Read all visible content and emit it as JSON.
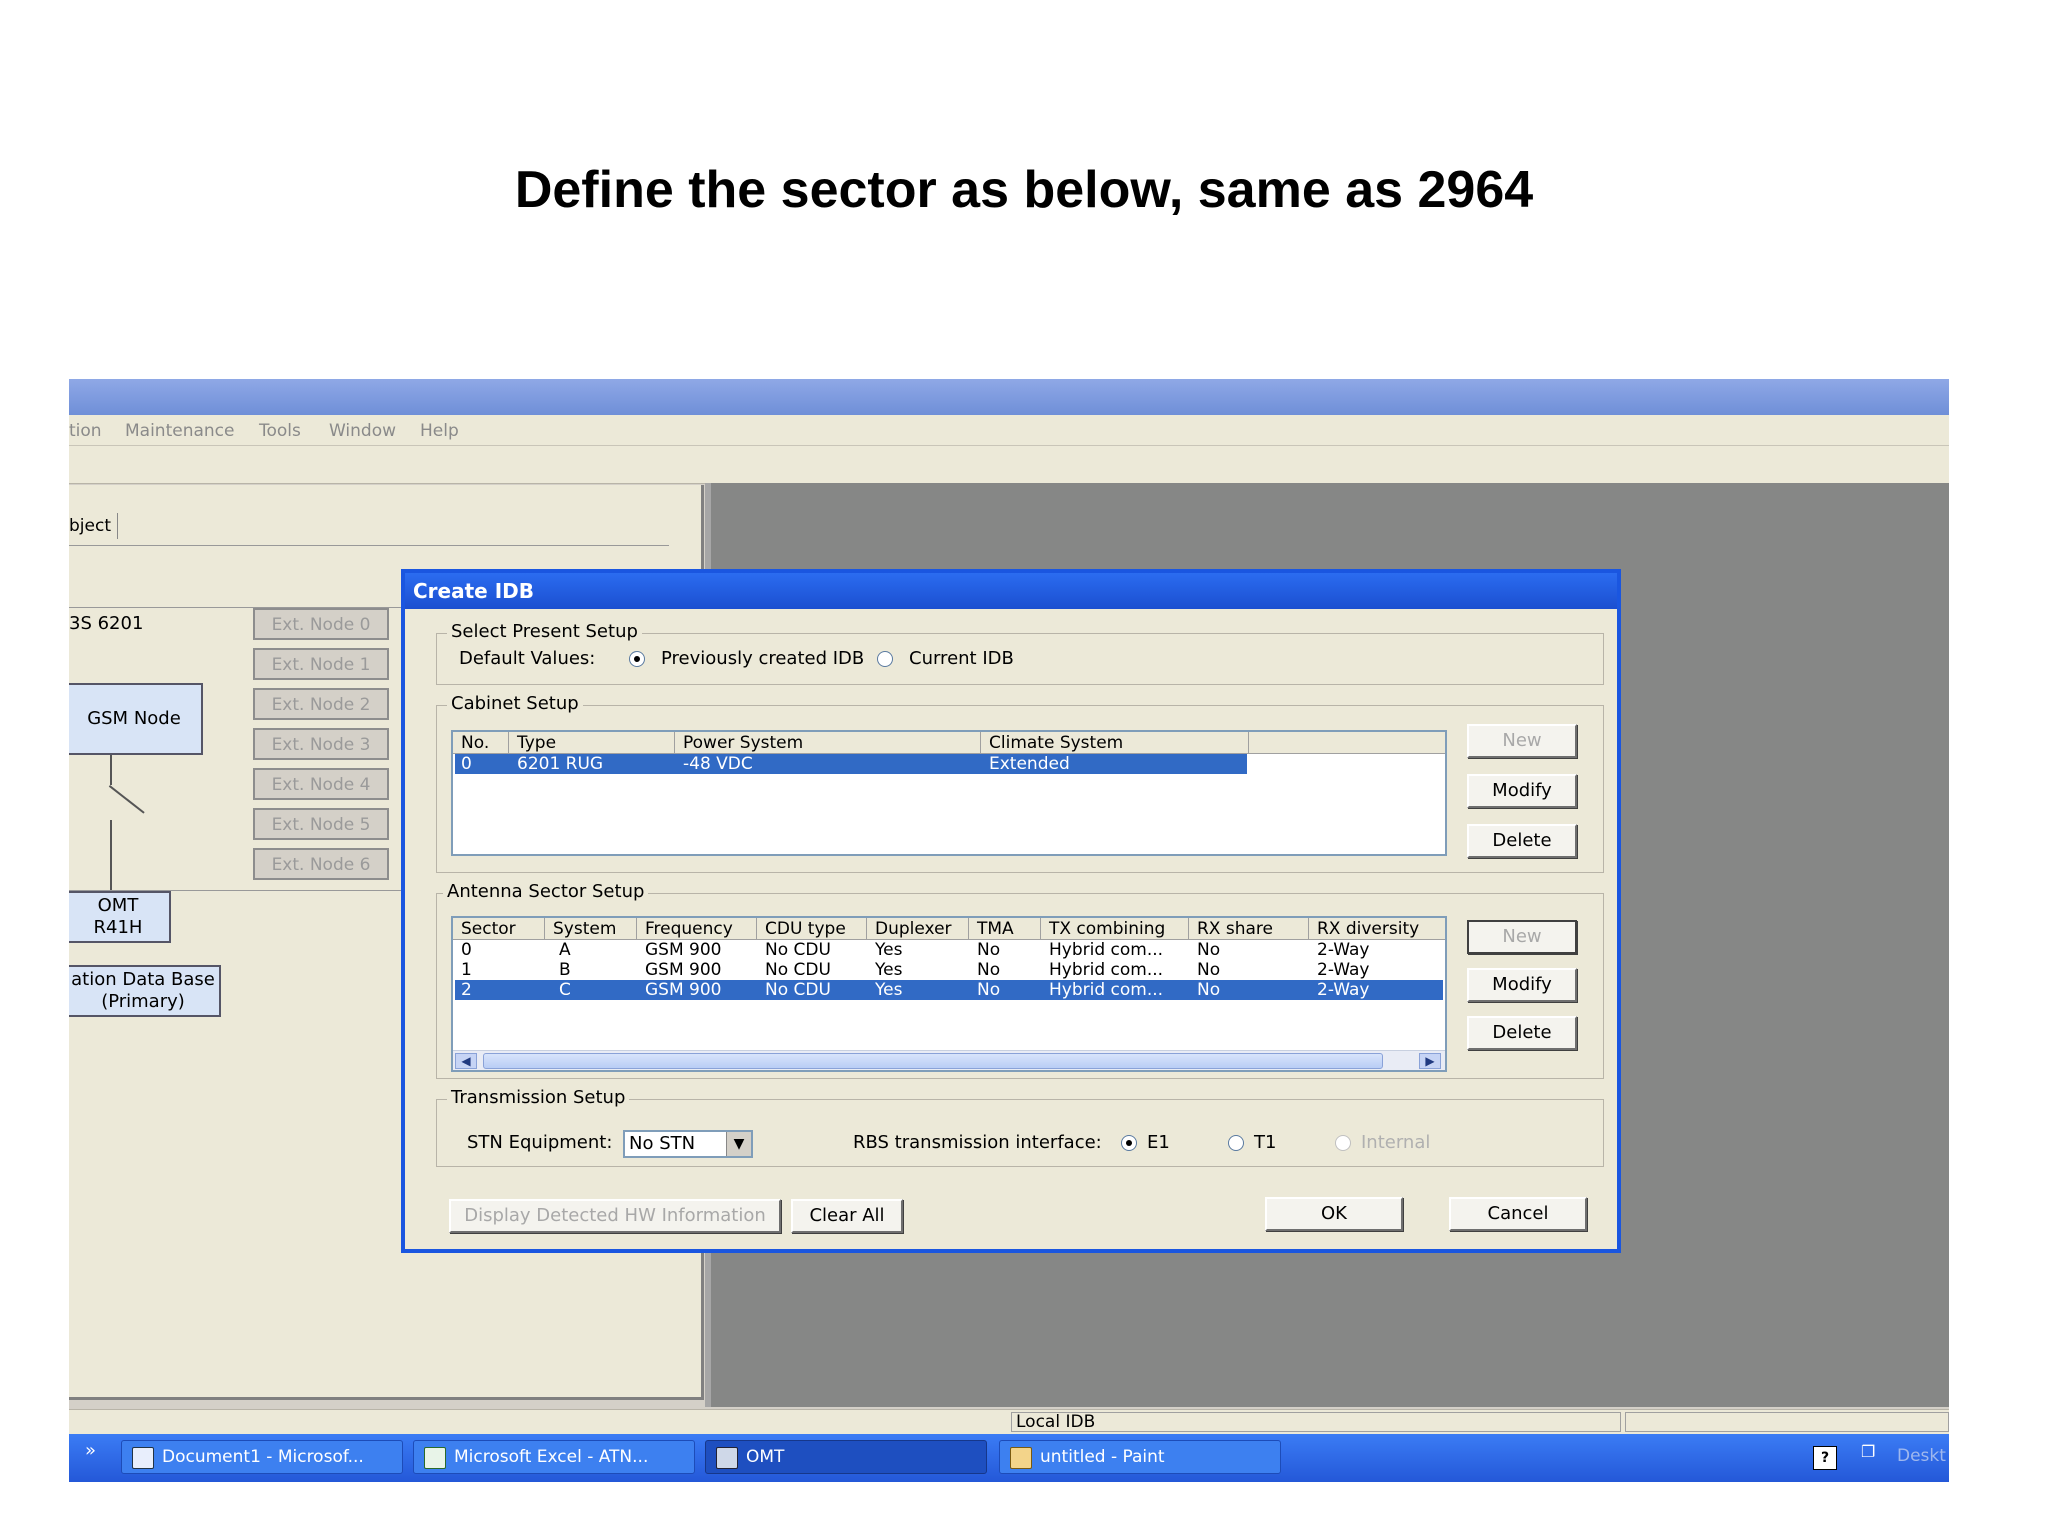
{
  "slide": {
    "title": "Define the sector as below, same as 2964"
  },
  "menu": [
    "tion",
    "Maintenance",
    "Tools",
    "Window",
    "Help"
  ],
  "left_panel": {
    "tab": "bject",
    "rbs_label": "3S 6201",
    "ext_nodes": [
      "Ext. Node 0",
      "Ext. Node 1",
      "Ext. Node 2",
      "Ext. Node 3",
      "Ext. Node 4",
      "Ext. Node 5",
      "Ext. Node 6"
    ],
    "gsm_node": "GSM Node",
    "omt_line1": "OMT",
    "omt_line2": "R41H",
    "db_line1": "ation Data Base",
    "db_line2": "(Primary)"
  },
  "dialog": {
    "title": "Create IDB",
    "select_setup": {
      "label": "Select Present Setup",
      "default_values": "Default Values:",
      "opt_previous": "Previously created IDB",
      "opt_current": "Current IDB",
      "selected": "Previously created IDB"
    },
    "cabinet": {
      "label": "Cabinet Setup",
      "columns": [
        "No.",
        "Type",
        "Power System",
        "Climate System"
      ],
      "rows": [
        [
          "0",
          "6201 RUG",
          "-48 VDC",
          "Extended"
        ]
      ],
      "buttons": {
        "new": "New",
        "modify": "Modify",
        "delete": "Delete"
      }
    },
    "antenna": {
      "label": "Antenna Sector Setup",
      "columns": [
        "Sector",
        "System",
        "Frequency",
        "CDU type",
        "Duplexer",
        "TMA",
        "TX combining",
        "RX share",
        "RX diversity"
      ],
      "rows": [
        [
          "0",
          "A",
          "GSM 900",
          "No CDU",
          "Yes",
          "No",
          "Hybrid com...",
          "No",
          "2-Way"
        ],
        [
          "1",
          "B",
          "GSM 900",
          "No CDU",
          "Yes",
          "No",
          "Hybrid com...",
          "No",
          "2-Way"
        ],
        [
          "2",
          "C",
          "GSM 900",
          "No CDU",
          "Yes",
          "No",
          "Hybrid com...",
          "No",
          "2-Way"
        ]
      ],
      "selected_row": 2,
      "buttons": {
        "new": "New",
        "modify": "Modify",
        "delete": "Delete"
      }
    },
    "transmission": {
      "label": "Transmission Setup",
      "stn_label": "STN Equipment:",
      "stn_value": "No STN",
      "rbs_label": "RBS transmission interface:",
      "opt_e1": "E1",
      "opt_t1": "T1",
      "opt_internal": "Internal",
      "selected": "E1"
    },
    "footer": {
      "display_hw": "Display Detected HW Information",
      "clear_all": "Clear All",
      "ok": "OK",
      "cancel": "Cancel"
    }
  },
  "status_bar": {
    "text": "Local IDB"
  },
  "taskbar": {
    "chevron": "»",
    "tasks": [
      "Document1 - Microsof...",
      "Microsoft Excel - ATN...",
      "OMT",
      "untitled - Paint"
    ],
    "active": "OMT",
    "tray_text": "Deskt"
  },
  "colors": {
    "selection": "#316ac5",
    "dialog_border": "#1a56e0",
    "taskbar": "#2458d8"
  }
}
